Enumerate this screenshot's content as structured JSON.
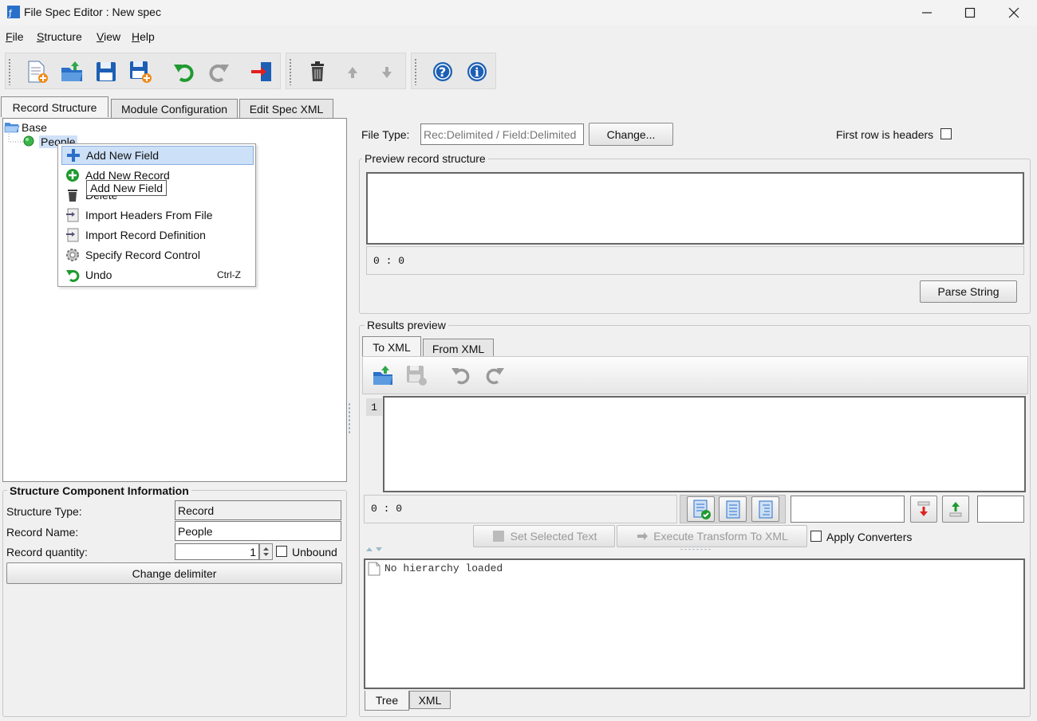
{
  "window": {
    "title": "File Spec Editor : New spec"
  },
  "menu": {
    "items": [
      {
        "u": "F",
        "rest": "ile"
      },
      {
        "u": "S",
        "rest": "tructure"
      },
      {
        "u": "V",
        "rest": "iew"
      },
      {
        "u": "H",
        "rest": "elp"
      }
    ]
  },
  "tabs": {
    "record_structure": "Record Structure",
    "module_configuration": "Module Configuration",
    "edit_spec_xml": "Edit Spec XML"
  },
  "tree": {
    "root": "Base",
    "child": "People"
  },
  "context_menu": {
    "items": [
      {
        "label": "Add New Field",
        "shortcut": ""
      },
      {
        "label": "Add New Record",
        "shortcut": ""
      },
      {
        "label": "Delete",
        "shortcut": ""
      },
      {
        "label": "Import Headers From File",
        "shortcut": ""
      },
      {
        "label": "Import Record Definition",
        "shortcut": ""
      },
      {
        "label": "Specify Record Control",
        "shortcut": ""
      },
      {
        "label": "Undo",
        "shortcut": "Ctrl-Z"
      }
    ],
    "tooltip": "Add New Field"
  },
  "structure_info": {
    "title": "Structure Component Information",
    "structure_type_label": "Structure Type:",
    "structure_type_value": "Record",
    "record_name_label": "Record Name:",
    "record_name_value": "People",
    "record_quantity_label": "Record quantity:",
    "record_quantity_value": "1",
    "unbound_label": "Unbound",
    "change_delimiter": "Change delimiter"
  },
  "file_type": {
    "label": "File Type:",
    "placeholder": "Rec:Delimited / Field:Delimited",
    "change_button": "Change...",
    "first_row_label": "First row is headers"
  },
  "preview": {
    "title": "Preview record structure",
    "position": "0 : 0",
    "parse_button": "Parse String"
  },
  "results": {
    "title": "Results preview",
    "tab_to_xml": "To XML",
    "tab_from_xml": "From XML",
    "line_number": "1",
    "position": "0 : 0",
    "set_selected_text": "Set Selected Text",
    "execute_transform": "Execute Transform To XML",
    "apply_converters": "Apply Converters",
    "hierarchy_text": "No hierarchy loaded",
    "tab_tree": "Tree",
    "tab_xml": "XML"
  }
}
